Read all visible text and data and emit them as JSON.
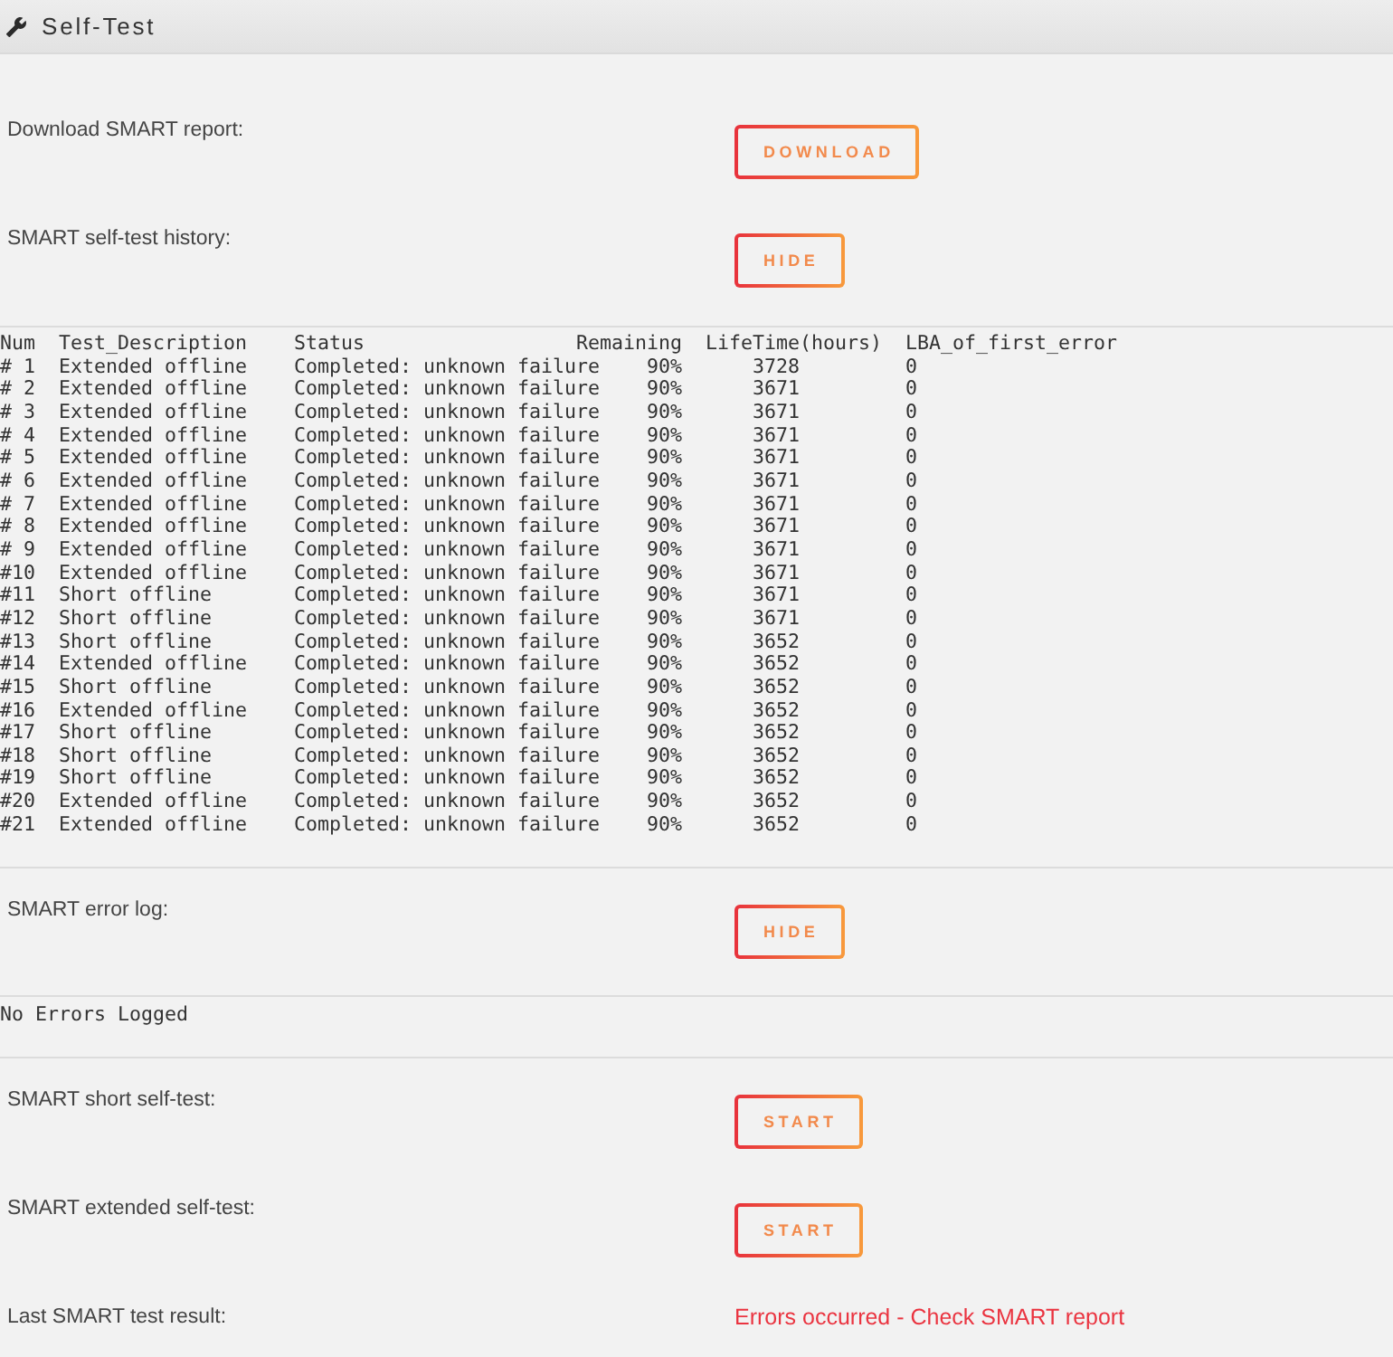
{
  "panel": {
    "title": "Self-Test"
  },
  "sections": [
    {
      "kind": "actions",
      "rows": [
        {
          "kind": "button",
          "label": "Download SMART report:",
          "button": "DOWNLOAD"
        },
        {
          "kind": "button",
          "label": "SMART self-test history:",
          "button": "HIDE"
        }
      ]
    },
    {
      "kind": "log_table",
      "columns": [
        "Num",
        "Test_Description",
        "Status",
        "Remaining",
        "LifeTime(hours)",
        "LBA_of_first_error"
      ],
      "rows": [
        [
          "# 1",
          "Extended offline",
          "Completed: unknown failure",
          "90%",
          "3728",
          "0"
        ],
        [
          "# 2",
          "Extended offline",
          "Completed: unknown failure",
          "90%",
          "3671",
          "0"
        ],
        [
          "# 3",
          "Extended offline",
          "Completed: unknown failure",
          "90%",
          "3671",
          "0"
        ],
        [
          "# 4",
          "Extended offline",
          "Completed: unknown failure",
          "90%",
          "3671",
          "0"
        ],
        [
          "# 5",
          "Extended offline",
          "Completed: unknown failure",
          "90%",
          "3671",
          "0"
        ],
        [
          "# 6",
          "Extended offline",
          "Completed: unknown failure",
          "90%",
          "3671",
          "0"
        ],
        [
          "# 7",
          "Extended offline",
          "Completed: unknown failure",
          "90%",
          "3671",
          "0"
        ],
        [
          "# 8",
          "Extended offline",
          "Completed: unknown failure",
          "90%",
          "3671",
          "0"
        ],
        [
          "# 9",
          "Extended offline",
          "Completed: unknown failure",
          "90%",
          "3671",
          "0"
        ],
        [
          "#10",
          "Extended offline",
          "Completed: unknown failure",
          "90%",
          "3671",
          "0"
        ],
        [
          "#11",
          "Short offline",
          "Completed: unknown failure",
          "90%",
          "3671",
          "0"
        ],
        [
          "#12",
          "Short offline",
          "Completed: unknown failure",
          "90%",
          "3671",
          "0"
        ],
        [
          "#13",
          "Short offline",
          "Completed: unknown failure",
          "90%",
          "3652",
          "0"
        ],
        [
          "#14",
          "Extended offline",
          "Completed: unknown failure",
          "90%",
          "3652",
          "0"
        ],
        [
          "#15",
          "Short offline",
          "Completed: unknown failure",
          "90%",
          "3652",
          "0"
        ],
        [
          "#16",
          "Extended offline",
          "Completed: unknown failure",
          "90%",
          "3652",
          "0"
        ],
        [
          "#17",
          "Short offline",
          "Completed: unknown failure",
          "90%",
          "3652",
          "0"
        ],
        [
          "#18",
          "Short offline",
          "Completed: unknown failure",
          "90%",
          "3652",
          "0"
        ],
        [
          "#19",
          "Short offline",
          "Completed: unknown failure",
          "90%",
          "3652",
          "0"
        ],
        [
          "#20",
          "Extended offline",
          "Completed: unknown failure",
          "90%",
          "3652",
          "0"
        ],
        [
          "#21",
          "Extended offline",
          "Completed: unknown failure",
          "90%",
          "3652",
          "0"
        ]
      ]
    },
    {
      "kind": "actions",
      "rows": [
        {
          "kind": "button",
          "label": "SMART error log:",
          "button": "HIDE"
        }
      ]
    },
    {
      "kind": "log_text",
      "text": "No Errors Logged"
    },
    {
      "kind": "actions",
      "rows": [
        {
          "kind": "button",
          "label": "SMART short self-test:",
          "button": "START"
        },
        {
          "kind": "button",
          "label": "SMART extended self-test:",
          "button": "START"
        },
        {
          "kind": "status",
          "label": "Last SMART test result:",
          "value": "Errors occurred - Check SMART report"
        }
      ]
    }
  ]
}
